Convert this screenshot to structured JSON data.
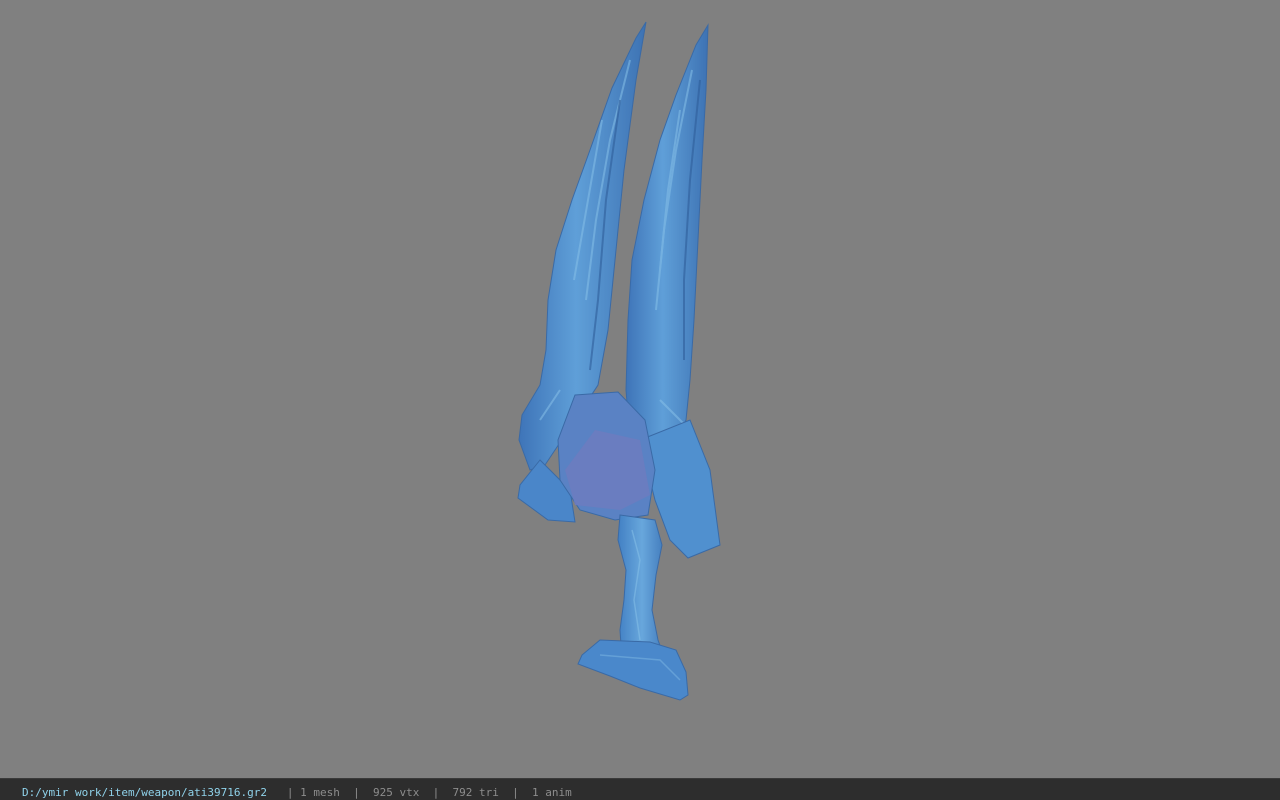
{
  "viewport": {
    "background": "#808080",
    "model": {
      "name": "blue-twin-bladed-weapon-model",
      "primary_color": "#4f8fd1",
      "highlight_color": "#74b3e4",
      "shadow_color": "#3b6fae",
      "guard_color": "#6f7ec6"
    }
  },
  "status_bar": {
    "file_path": "D:/ymir work/item/weapon/ati39716.gr2",
    "separator": "|",
    "mesh_count": "1 mesh",
    "vertex_count": "925 vtx",
    "triangle_count": "792 tri",
    "anim_count": "1 anim"
  }
}
